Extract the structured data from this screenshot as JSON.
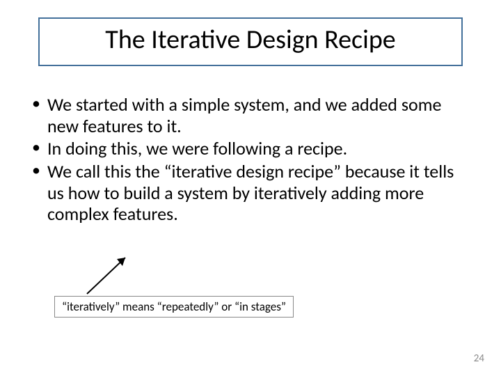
{
  "title": "The Iterative Design Recipe",
  "bullets": [
    "We started with a simple system, and we added some new features to it.",
    "In doing this, we were following a recipe.",
    "We call this the “iterative design recipe” because it tells us how to build a system by iteratively adding more complex features."
  ],
  "callout": "“iteratively” means “repeatedly” or “in stages”",
  "page_number": "24"
}
